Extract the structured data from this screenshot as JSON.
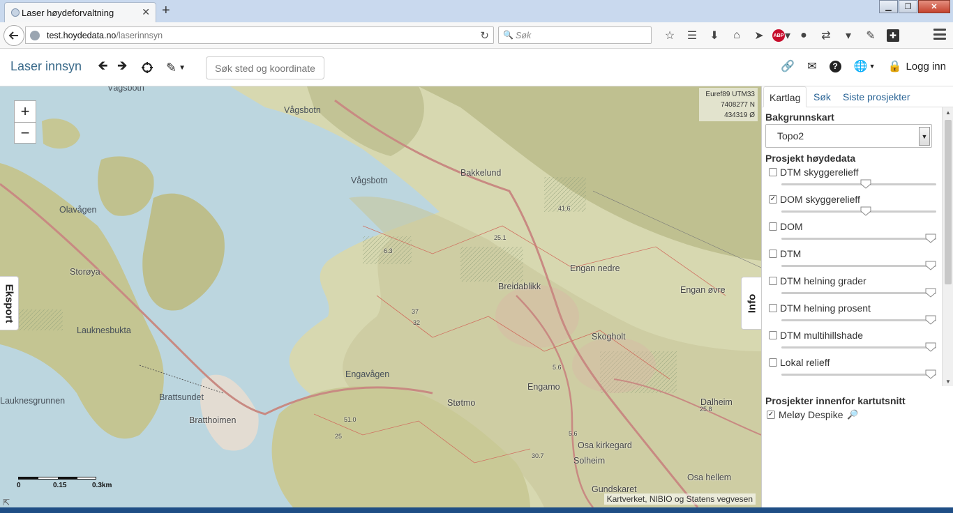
{
  "browser": {
    "tab_title": "Laser høydeforvaltning",
    "url_host": "test.hoydedata.no",
    "url_path": "/laserinnsyn",
    "search_placeholder": "Søk"
  },
  "app": {
    "brand": "Laser innsyn",
    "search_placeholder": "Søk sted og koordinater",
    "login_label": "Logg inn"
  },
  "map": {
    "coords": {
      "crs": "Euref89 UTM33",
      "north": "7408277 N",
      "east": "434319 Ø"
    },
    "tab_left": "Eksport",
    "tab_right": "Info",
    "scale": {
      "zero": "0",
      "mid": "0.15",
      "end": "0.3km"
    },
    "attribution": "Kartverket, NIBIO og Statens vegvesen",
    "places": [
      "Vågsbotn",
      "Vågsbotn",
      "Vågsbotn",
      "Bakkelund",
      "Olavågen",
      "Storøya",
      "Lauknesbukta",
      "Lauknesgrunnen",
      "Brattsundet",
      "Bratthoimen",
      "Engavågen",
      "Støtmo",
      "Engamo",
      "Breidablikk",
      "Engan nedre",
      "Engan øvre",
      "Skogholt",
      "Osa kirkegard",
      "Solheim",
      "Gundskaret",
      "Osa hellem",
      "Dalheim"
    ],
    "spot_heights": [
      "41.6",
      "25.1",
      "6.3",
      "37",
      "32",
      "5.6",
      "25.8",
      "51.0",
      "25",
      "30.7",
      "5.6"
    ]
  },
  "panel": {
    "tabs": [
      "Kartlag",
      "Søk",
      "Siste prosjekter"
    ],
    "active_tab": "Kartlag",
    "background_heading": "Bakgrunnskart",
    "background_value": "Topo2",
    "layers_heading": "Prosjekt høydedata",
    "layers": [
      {
        "label": "DTM skyggerelieff",
        "checked": false,
        "opacity": 0.55
      },
      {
        "label": "DOM skyggerelieff",
        "checked": true,
        "opacity": 0.55
      },
      {
        "label": "DOM",
        "checked": false,
        "opacity": 1.0
      },
      {
        "label": "DTM",
        "checked": false,
        "opacity": 1.0
      },
      {
        "label": "DTM helning grader",
        "checked": false,
        "opacity": 1.0
      },
      {
        "label": "DTM helning prosent",
        "checked": false,
        "opacity": 1.0
      },
      {
        "label": "DTM multihillshade",
        "checked": false,
        "opacity": 1.0
      },
      {
        "label": "Lokal relieff",
        "checked": false,
        "opacity": 1.0
      }
    ],
    "projects_heading": "Prosjekter innenfor kartutsnitt",
    "project": {
      "label": "Meløy Despike",
      "checked": true
    }
  },
  "colors": {
    "water": "#bcd6df",
    "land": "#d9dbb4",
    "terrain": "#b9b987",
    "brand": "#3a6a8a",
    "link": "#2a6496"
  }
}
